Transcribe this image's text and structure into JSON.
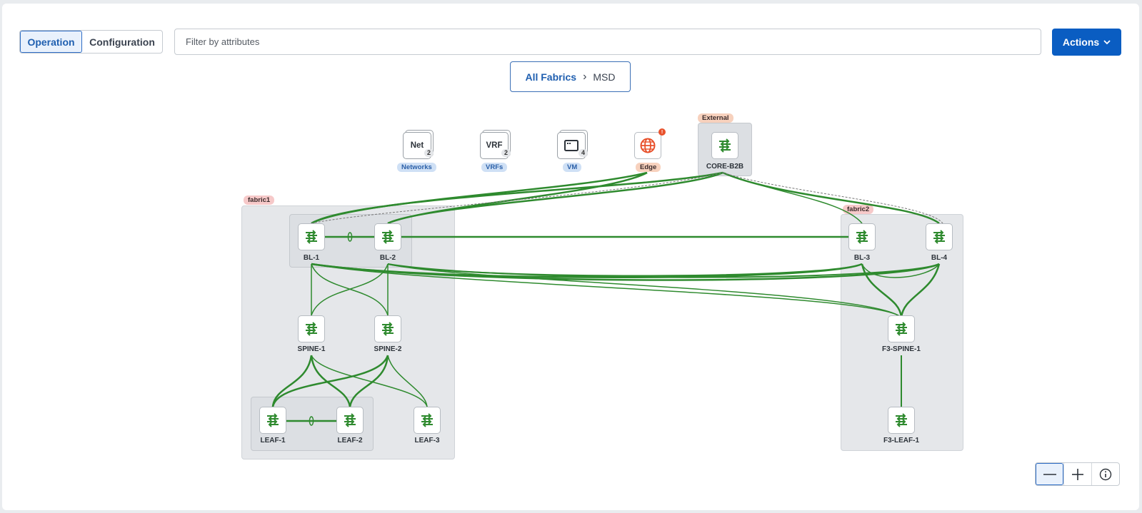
{
  "toolbar": {
    "mode_tabs": [
      {
        "label": "Operation",
        "active": true
      },
      {
        "label": "Configuration",
        "active": false
      }
    ],
    "filter_placeholder": "Filter by attributes",
    "actions_label": "Actions"
  },
  "breadcrumb": {
    "root": "All Fabrics",
    "separator": "›",
    "current": "MSD"
  },
  "services": {
    "networks": {
      "code": "Net",
      "count": "2",
      "label": "Networks"
    },
    "vrfs": {
      "code": "VRF",
      "count": "2",
      "label": "VRFs"
    },
    "vm": {
      "count": "4",
      "label": "VM"
    },
    "edge": {
      "label": "Edge",
      "alert": "!"
    }
  },
  "groups": {
    "external": "External",
    "fabric1": "fabric1",
    "fabric2": "fabric2"
  },
  "nodes": {
    "core": "CORE-B2B",
    "bl1": "BL-1",
    "bl2": "BL-2",
    "bl3": "BL-3",
    "bl4": "BL-4",
    "spine1": "SPINE-1",
    "spine2": "SPINE-2",
    "f3spine1": "F3-SPINE-1",
    "leaf1": "LEAF-1",
    "leaf2": "LEAF-2",
    "leaf3": "LEAF-3",
    "f3leaf1": "F3-LEAF-1"
  },
  "colors": {
    "accent": "#0a5dc2",
    "link_green": "#2e8a2e",
    "alert_orange": "#e8512b"
  },
  "icons": {
    "switch": "switch-arrows-icon",
    "edge": "globe-icon",
    "vm": "window-icon",
    "actions": "chevron-down-icon",
    "zoom_out": "minus-icon",
    "zoom_in": "plus-icon",
    "info": "info-icon"
  }
}
